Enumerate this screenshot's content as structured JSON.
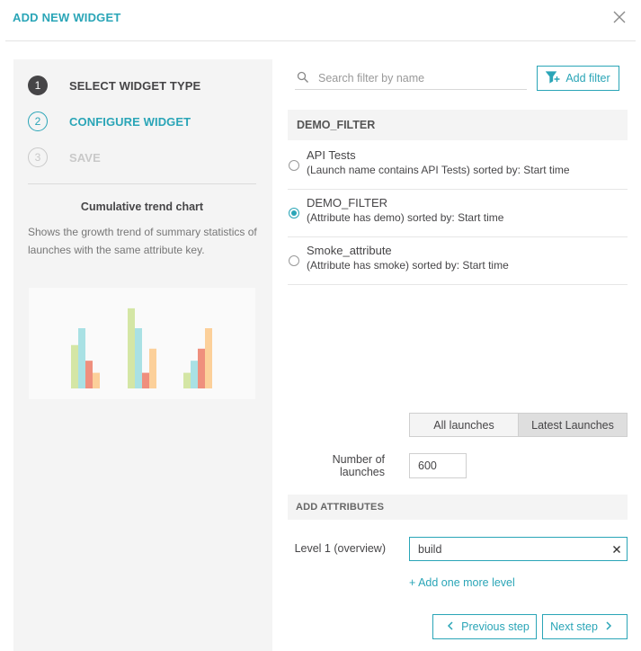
{
  "modal": {
    "title": "ADD NEW WIDGET"
  },
  "steps": [
    {
      "number": "1",
      "label": "SELECT WIDGET TYPE",
      "state": "done"
    },
    {
      "number": "2",
      "label": "CONFIGURE WIDGET",
      "state": "active"
    },
    {
      "number": "3",
      "label": "SAVE",
      "state": "pending"
    }
  ],
  "widget_info": {
    "title": "Cumulative trend chart",
    "description": "Shows the growth trend of summary statistics of launches with the same attribute key."
  },
  "preview_chart": {
    "colors": [
      "#d4e6a5",
      "#a9e1e4",
      "#ef8f7d",
      "#fcd09a"
    ],
    "groups": [
      [
        0.72,
        1.0,
        0.46,
        0.26
      ],
      [
        1.33,
        1.0,
        0.26,
        0.66
      ],
      [
        0.26,
        0.46,
        0.66,
        1.0
      ]
    ]
  },
  "filter_search": {
    "placeholder": "Search filter by name",
    "add_filter_label": "Add filter"
  },
  "active_filter_name": "DEMO_FILTER",
  "filters": [
    {
      "name": "API Tests",
      "description": "(Launch name contains API Tests) sorted by: Start time",
      "selected": false
    },
    {
      "name": "DEMO_FILTER",
      "description": "(Attribute has demo) sorted by: Start time",
      "selected": true
    },
    {
      "name": "Smoke_attribute",
      "description": "(Attribute has smoke) sorted by: Start time",
      "selected": false
    }
  ],
  "launch_mode": {
    "all_label": "All launches",
    "latest_label": "Latest Launches",
    "selected": "latest"
  },
  "number_of_launches": {
    "label": "Number of launches",
    "value": "600"
  },
  "attributes": {
    "header": "ADD ATTRIBUTES",
    "level_label": "Level 1 (overview)",
    "level_value": "build",
    "add_level_label": "+ Add one more level"
  },
  "navigation": {
    "prev_label": "Previous step",
    "next_label": "Next step"
  },
  "colors": {
    "accent": "#2aa5b7",
    "text": "#464547",
    "panel_bg": "#f4f4f4"
  }
}
